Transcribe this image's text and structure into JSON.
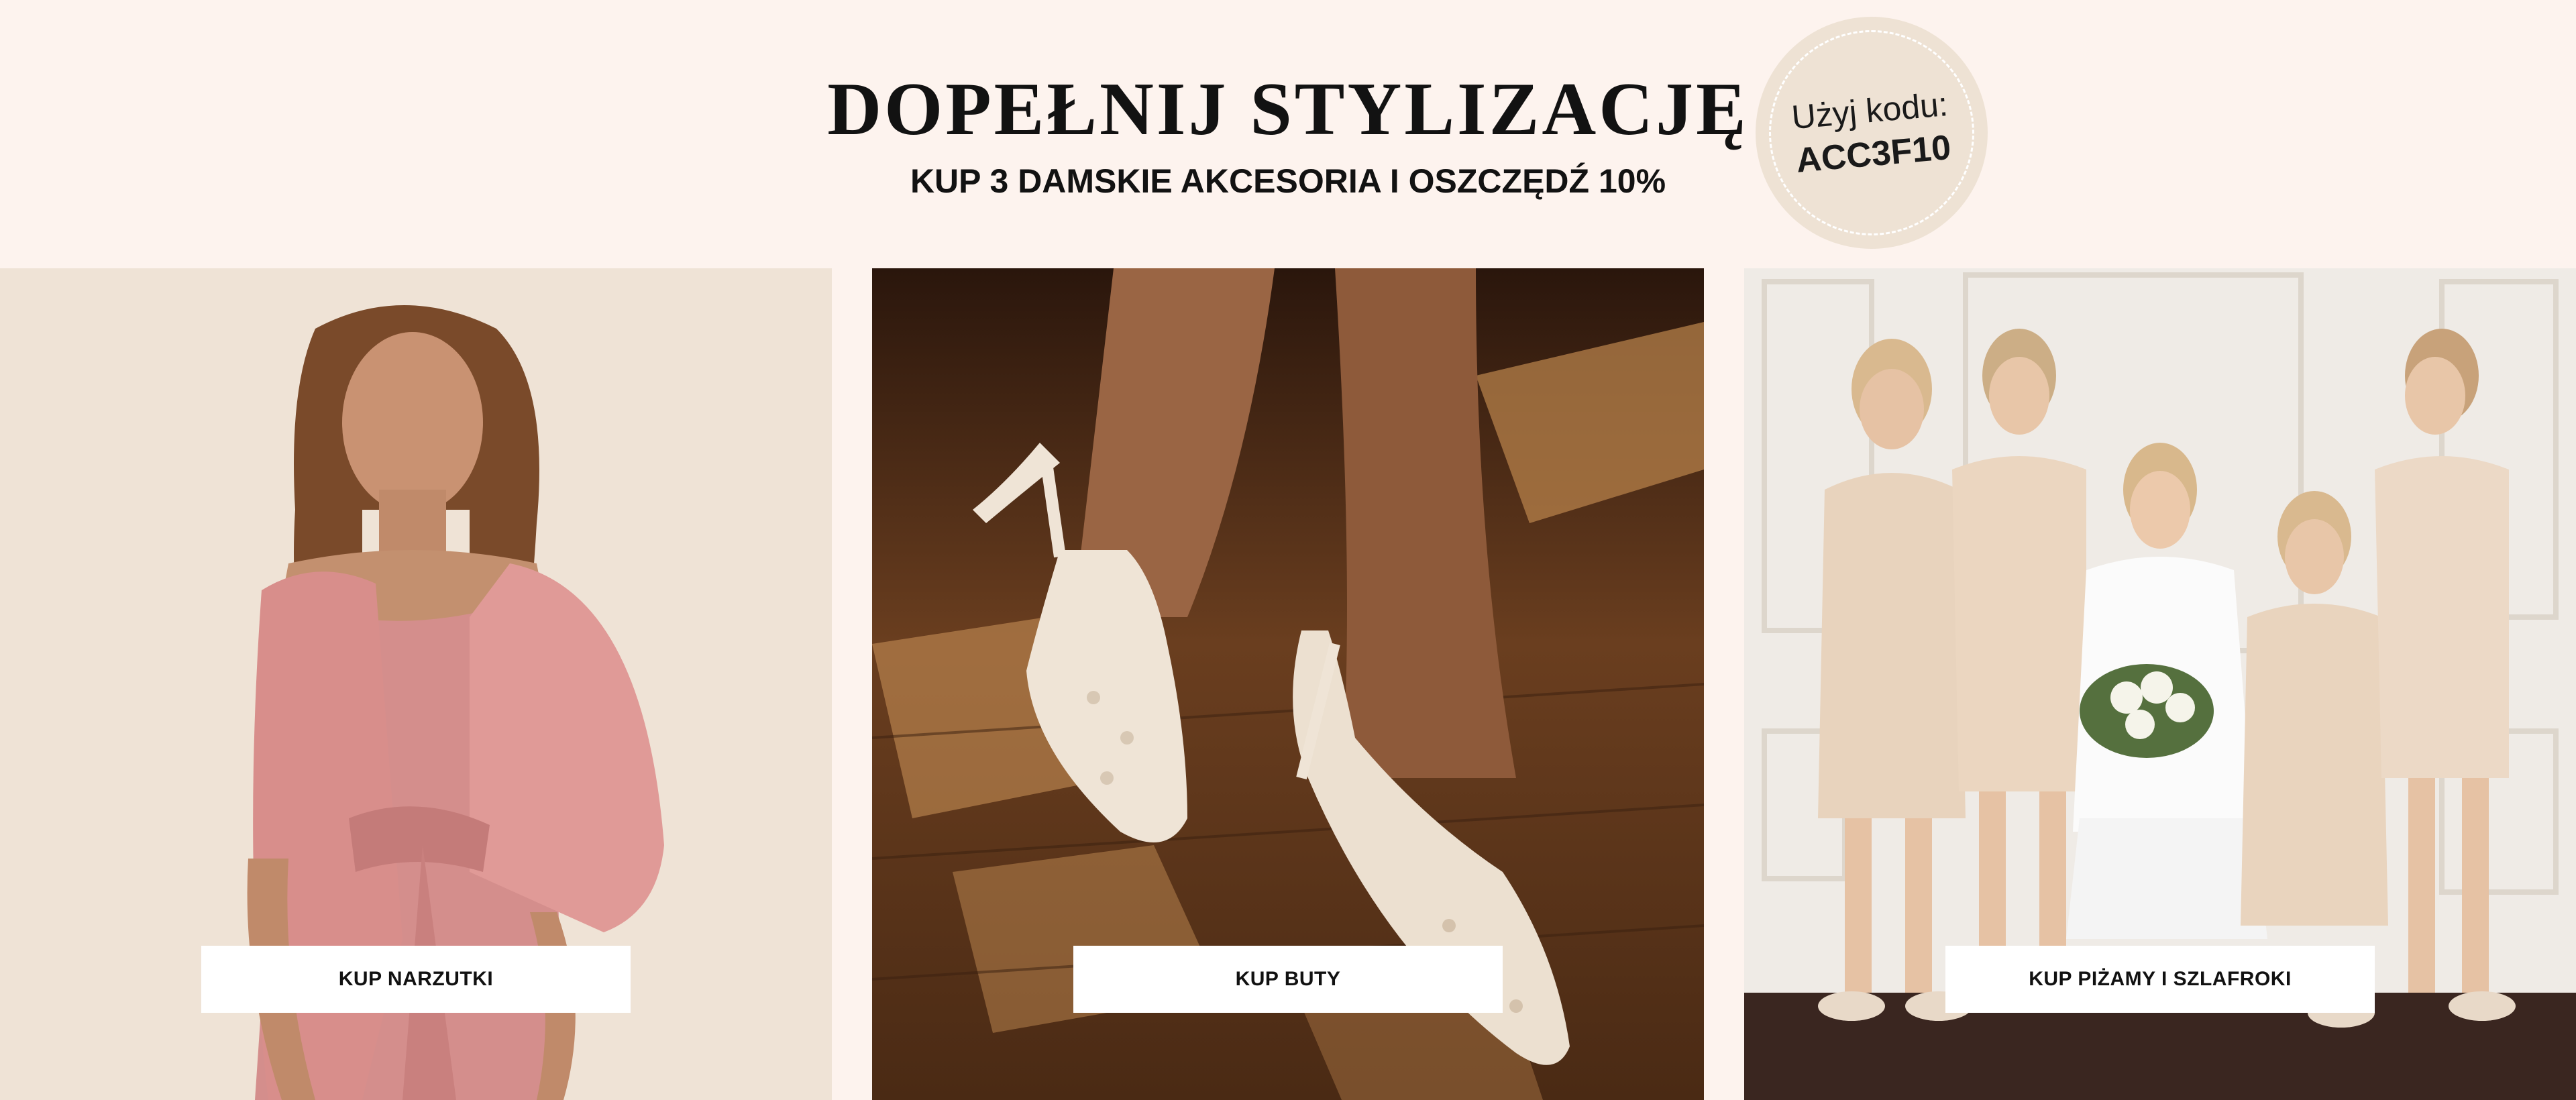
{
  "header": {
    "title": "DOPEŁNIJ STYLIZACJĘ",
    "subtitle": "KUP 3 DAMSKIE AKCESORIA I OSZCZĘDŹ 10%"
  },
  "promo_badge": {
    "line1": "Użyj kodu:",
    "code": "ACC3F10"
  },
  "tiles": [
    {
      "button_label": "KUP NARZUTKI",
      "photo": "woman-in-pink-dress-and-wrap"
    },
    {
      "button_label": "KUP BUTY",
      "photo": "beaded-bridal-slingback-heels"
    },
    {
      "button_label": "KUP PIŻAMY I SZLAFROKI",
      "photo": "bridal-party-in-satin-robes"
    }
  ],
  "colors": {
    "background": "#fdf3ee",
    "badge": "#eee2d4",
    "tile1_bg": "#efe3d6",
    "text": "#121212",
    "button_bg": "#ffffff"
  }
}
